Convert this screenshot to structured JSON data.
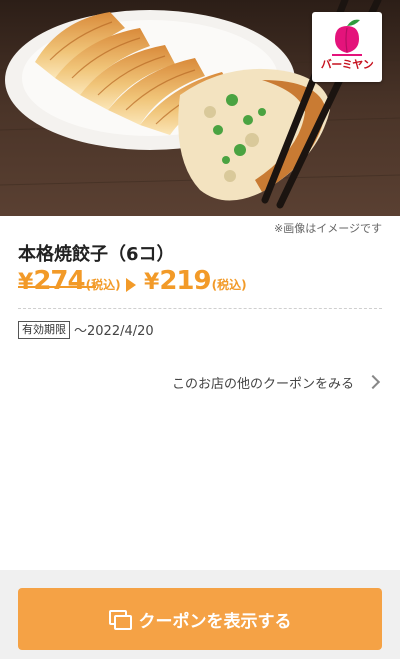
{
  "hero": {
    "image_note": "※画像はイメージです",
    "logo_text": "バーミヤン"
  },
  "product": {
    "title": "本格焼餃子（6コ）",
    "original_price": {
      "yen": "¥",
      "amount": "274",
      "tax": "(税込)"
    },
    "sale_price": {
      "yen": "¥",
      "amount": "219",
      "tax": "(税込)"
    },
    "validity_label": "有効期限",
    "validity_date": "〜2022/4/20"
  },
  "links": {
    "other_coupons": "このお店の他のクーポンをみる"
  },
  "actions": {
    "show_coupon": "クーポンを表示する"
  },
  "colors": {
    "accent": "#f29a28",
    "button": "#f5a245",
    "brand_red": "#c6121f"
  }
}
